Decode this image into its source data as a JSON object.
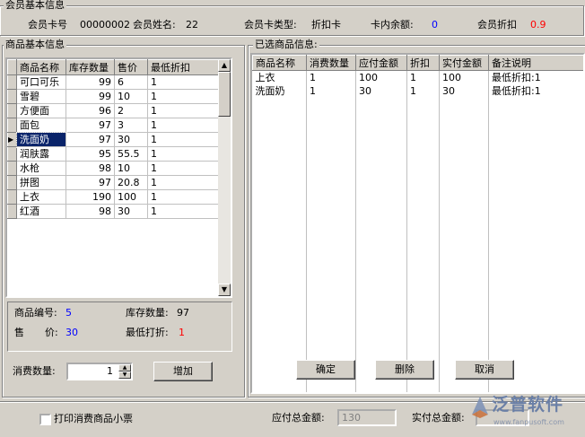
{
  "member": {
    "group_title": "会员基本信息",
    "card_no_label": "会员卡号",
    "card_no": "00000002",
    "name_label": "会员姓名:",
    "name": "22",
    "card_type_label": "会员卡类型:",
    "card_type": "折扣卡",
    "balance_label": "卡内余额:",
    "balance": "0",
    "discount_label": "会员折扣",
    "discount": "0.9"
  },
  "products": {
    "group_title": "商品基本信息",
    "columns": [
      "商品名称",
      "库存数量",
      "售价",
      "最低折扣"
    ],
    "rows": [
      {
        "name": "可口可乐",
        "stock": "99",
        "price": "6",
        "min_discount": "1"
      },
      {
        "name": "雪碧",
        "stock": "99",
        "price": "10",
        "min_discount": "1"
      },
      {
        "name": "方便面",
        "stock": "96",
        "price": "2",
        "min_discount": "1"
      },
      {
        "name": "面包",
        "stock": "97",
        "price": "3",
        "min_discount": "1"
      },
      {
        "name": "洗面奶",
        "stock": "97",
        "price": "30",
        "min_discount": "1"
      },
      {
        "name": "润肤露",
        "stock": "95",
        "price": "55.5",
        "min_discount": "1"
      },
      {
        "name": "水枪",
        "stock": "98",
        "price": "10",
        "min_discount": "1"
      },
      {
        "name": "拼图",
        "stock": "97",
        "price": "20.8",
        "min_discount": "1"
      },
      {
        "name": "上衣",
        "stock": "190",
        "price": "100",
        "min_discount": "1"
      },
      {
        "name": "红酒",
        "stock": "98",
        "price": "30",
        "min_discount": "1"
      }
    ],
    "selected_index": 4
  },
  "detail": {
    "code_label": "商品编号:",
    "code": "5",
    "stock_label": "库存数量:",
    "stock": "97",
    "price_label_1": "售",
    "price_label_2": "价:",
    "price": "30",
    "min_discount_label": "最低打折:",
    "min_discount": "1"
  },
  "quantity": {
    "label": "消费数量:",
    "value": "1",
    "add_button": "增加"
  },
  "selected": {
    "group_title": "已选商品信息:",
    "columns": [
      "商品名称",
      "消费数量",
      "应付金额",
      "折扣",
      "实付金额",
      "备注说明"
    ],
    "rows": [
      {
        "name": "上衣",
        "qty": "1",
        "payable": "100",
        "discount": "1",
        "paid": "100",
        "note": "最低折扣:1"
      },
      {
        "name": "洗面奶",
        "qty": "1",
        "payable": "30",
        "discount": "1",
        "paid": "30",
        "note": "最低折扣:1"
      }
    ],
    "ok_button": "确定",
    "delete_button": "删除",
    "cancel_button": "取消"
  },
  "footer": {
    "print_label": "打印消费商品小票",
    "total_payable_label": "应付总金额:",
    "total_payable": "130",
    "total_paid_label": "实付总金额:"
  },
  "watermark": {
    "brand": "泛普软件",
    "url": "www.fanpusoft.com"
  }
}
